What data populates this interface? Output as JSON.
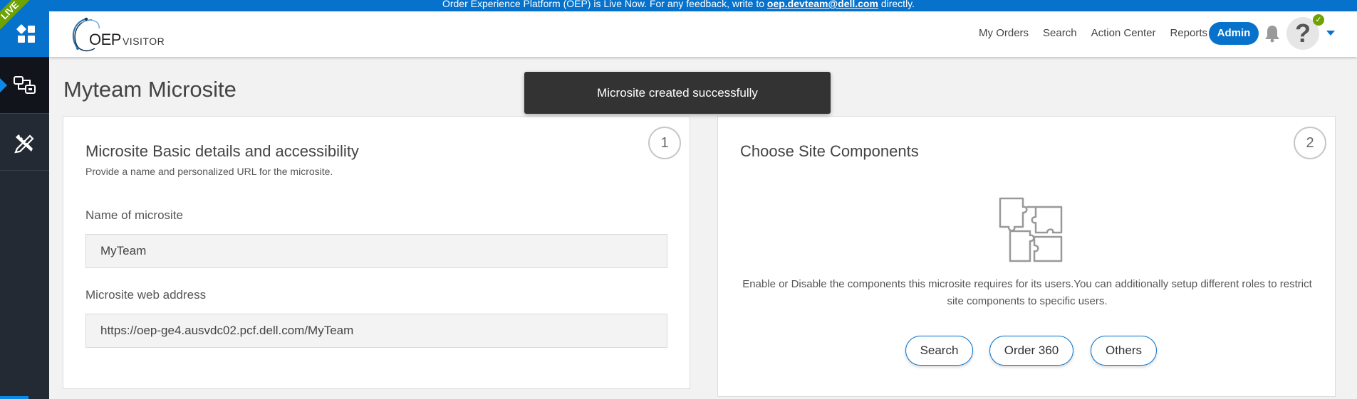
{
  "banner": {
    "text_before": "Order Experience Platform (OEP) is Live Now. For any feedback, write to",
    "email": "oep.devteam@dell.com",
    "text_after": "directly."
  },
  "sidebar": {
    "live_label": "LIVE",
    "items": [
      {
        "icon": "dashboard-grid-icon"
      },
      {
        "icon": "sitemap-icon",
        "active": true
      },
      {
        "icon": "design-tools-icon"
      }
    ]
  },
  "header": {
    "logo_text": "OEP",
    "logo_subtext": "VISITOR",
    "nav": [
      "My Orders",
      "Search",
      "Action Center",
      "Reports"
    ],
    "admin_label": "Admin",
    "avatar_glyph": "?",
    "avatar_status": "✓"
  },
  "page": {
    "title": "Myteam Microsite"
  },
  "toast": {
    "message": "Microsite created successfully"
  },
  "card1": {
    "step": "1",
    "title": "Microsite Basic details and accessibility",
    "subtitle": "Provide a name and personalized URL for the microsite.",
    "name_label": "Name of microsite",
    "name_value": "MyTeam",
    "address_label": "Microsite web address",
    "address_value": "https://oep-ge4.ausvdc02.pcf.dell.com/MyTeam"
  },
  "card2": {
    "step": "2",
    "title": "Choose Site Components",
    "description": "Enable or Disable the components this microsite requires for its users.You can additionally setup different roles to restrict site components to specific users.",
    "buttons": [
      "Search",
      "Order 360",
      "Others"
    ]
  },
  "colors": {
    "brand_blue": "#0672cb",
    "live_green": "#6ea204",
    "sidebar_dark": "#242a33",
    "toast_bg": "#333333"
  }
}
